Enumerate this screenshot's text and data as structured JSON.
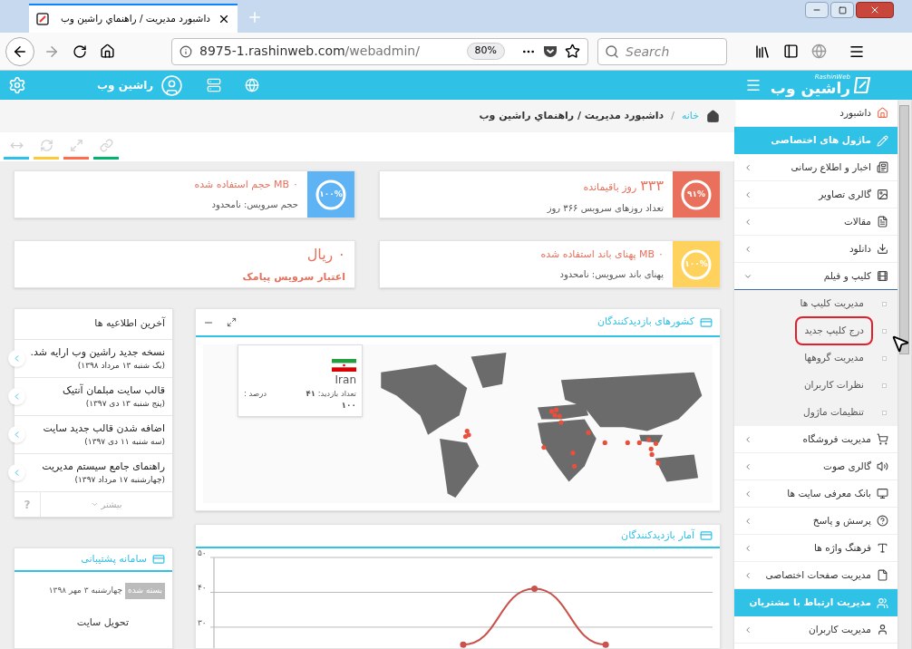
{
  "browser": {
    "tab_title": "داشبورد مدیریت / راهنماي راشين وب",
    "url_host": "8975-1.rashinweb.com",
    "url_path": "/webadmin/",
    "zoom": "80%",
    "search_placeholder": "Search"
  },
  "header": {
    "logo": "راشین وب",
    "logo_sub": "RashinWeb",
    "user": "راشین وب"
  },
  "breadcrumb": {
    "items": [
      {
        "label": "خانه",
        "link": true
      },
      {
        "label": "داشبورد مدیریت / راهنماي راشين وب",
        "link": false
      }
    ],
    "separator": "/"
  },
  "tools": [
    {
      "color": "#00b46e"
    },
    {
      "color": "#ff6c4c"
    },
    {
      "color": "#fdc93a"
    },
    {
      "color": "#2ec0e8"
    }
  ],
  "stats": [
    {
      "kind": "gauge",
      "color": "#e8705c",
      "gauge_label": "۹۱%",
      "value": "۳۳۳",
      "large": true,
      "title": "روز باقیمانده",
      "subtitle": "تعداد روزهای سرویس ۳۶۶ روز"
    },
    {
      "kind": "gauge",
      "color": "#5eb3f5",
      "gauge_label": "۱۰۰%",
      "value": "۰",
      "large": false,
      "title": "MB حجم استفاده شده",
      "subtitle": "حجم سرویس: نامحدود"
    },
    {
      "kind": "gauge",
      "color": "#fed25c",
      "gauge_label": "۱۰۰%",
      "value": "۰",
      "large": false,
      "title": "MB پهنای باند استفاده شده",
      "subtitle": "پهنای باند سرویس: نامحدود"
    },
    {
      "kind": "plain",
      "value": "۰ ریال",
      "large": true,
      "subtitle": "اعتبار سرویس پیامک"
    }
  ],
  "notices": {
    "title": "آخرین اطلاعیه ها",
    "items": [
      {
        "title": "نسخه جدید راشین وب ارایه شد.",
        "date": "(یک شنبه ۱۳ مرداد ۱۳۹۸)"
      },
      {
        "title": "قالب سایت مبلمان آنتیک",
        "date": "(پنج شنبه ۱۳ دی ۱۳۹۷)"
      },
      {
        "title": "اضافه شدن قالب جدید سایت",
        "date": "(سه شنبه ۱۱ دی ۱۳۹۷)"
      },
      {
        "title": "راهنمای جامع سیستم مدیریت",
        "date": "(چهارشنبه ۱۷ مرداد ۱۳۹۷)"
      }
    ],
    "more": "بیشتر",
    "help": "?"
  },
  "support": {
    "title": "سامانه پشتیبانی",
    "tickets": [
      {
        "date": "چهارشنبه ۳ مهر ۱۳۹۸",
        "status": "بسته شده",
        "subject": "تحویل سایت"
      }
    ]
  },
  "map_panel": {
    "title": "کشورهای بازدیدکنندگان",
    "tooltip": {
      "country": "Iran",
      "visits_label": "تعداد بازدید:",
      "visits": "۴۱",
      "percent_label": "درصد :",
      "percent": "۱۰۰"
    }
  },
  "chart_panel": {
    "title": "آمار بازدیدکنندگان",
    "chart_data": {
      "type": "line",
      "ylim": [
        24,
        50
      ],
      "yticks": [
        {
          "value": 30,
          "label": "۳۰"
        },
        {
          "value": 40,
          "label": "۴۰"
        },
        {
          "value": 50,
          "label": "۵۰"
        }
      ],
      "series": [
        {
          "color": "#c9524c",
          "marker": "circle",
          "values": [
            null,
            null,
            null,
            25,
            41,
            25,
            null
          ]
        }
      ]
    }
  },
  "sidebar": {
    "items": [
      {
        "kind": "link",
        "label": "داشبورد"
      },
      {
        "kind": "section",
        "label": "ماژول های اختصاصی"
      },
      {
        "kind": "menu",
        "label": "اخبار و اطلاع رسانی",
        "expanded": false
      },
      {
        "kind": "menu",
        "label": "گالری تصاویر",
        "expanded": false
      },
      {
        "kind": "menu",
        "label": "مقالات",
        "expanded": false
      },
      {
        "kind": "menu",
        "label": "دانلود",
        "expanded": false
      },
      {
        "kind": "menu",
        "label": "کلیپ و فیلم",
        "expanded": true,
        "children": [
          {
            "label": "مدیریت کلیپ ها",
            "highlighted": false
          },
          {
            "label": "درج کلیپ جدید",
            "highlighted": true
          },
          {
            "label": "مدیریت گروهها",
            "highlighted": false
          },
          {
            "label": "نظرات کاربران",
            "highlighted": false
          },
          {
            "label": "تنظیمات ماژول",
            "highlighted": false
          }
        ]
      },
      {
        "kind": "menu",
        "label": "مدیریت فروشگاه",
        "expanded": false
      },
      {
        "kind": "menu",
        "label": "گالری صوت",
        "expanded": false
      },
      {
        "kind": "menu",
        "label": "بانک معرفی سایت ها",
        "expanded": false
      },
      {
        "kind": "menu",
        "label": "پرسش و پاسخ",
        "expanded": false
      },
      {
        "kind": "menu",
        "label": "فرهنگ واژه ها",
        "expanded": false
      },
      {
        "kind": "menu",
        "label": "مدیریت صفحات اختصاصی",
        "expanded": false
      },
      {
        "kind": "section",
        "label": "مدیریت ارتباط با مشتریان"
      },
      {
        "kind": "menu",
        "label": "مدیریت کاربران",
        "expanded": false
      }
    ]
  }
}
